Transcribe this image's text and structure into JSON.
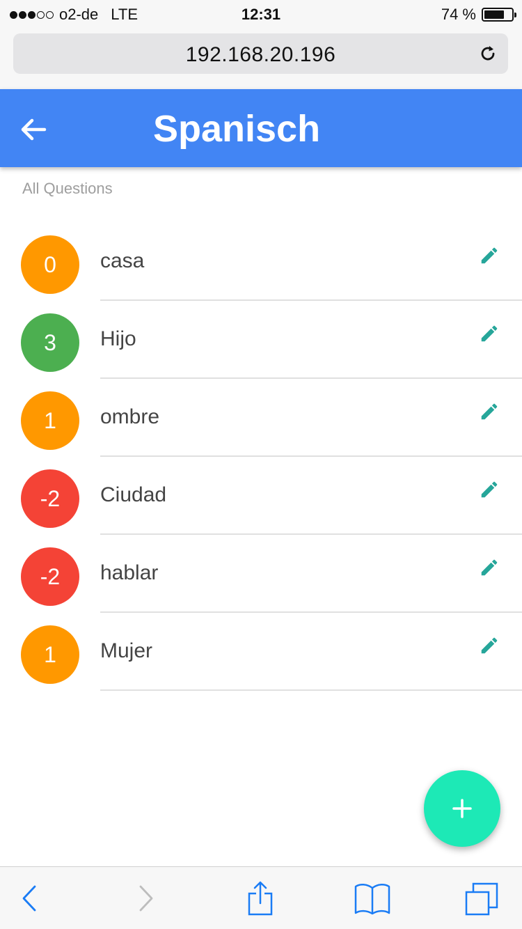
{
  "status_bar": {
    "carrier": "o2-de",
    "network": "LTE",
    "time": "12:31",
    "battery": "74 %",
    "battery_level": 0.74
  },
  "browser": {
    "url": "192.168.20.196"
  },
  "header": {
    "title": "Spanisch",
    "color": "#4285f4"
  },
  "section_label": "All Questions",
  "colors": {
    "positive": "#4caf50",
    "neutral": "#ff9800",
    "negative": "#f44336",
    "edit_icon": "#26a69a",
    "fab": "#1de9b6",
    "ios_blue": "#1a7cf5"
  },
  "questions": [
    {
      "score": "0",
      "word": "casa",
      "status": "neutral"
    },
    {
      "score": "3",
      "word": "Hijo",
      "status": "positive"
    },
    {
      "score": "1",
      "word": "ombre",
      "status": "neutral"
    },
    {
      "score": "-2",
      "word": "Ciudad",
      "status": "negative"
    },
    {
      "score": "-2",
      "word": "hablar",
      "status": "negative"
    },
    {
      "score": "1",
      "word": "Mujer",
      "status": "neutral"
    }
  ],
  "icons": {
    "header_back": "arrow-back-icon",
    "row_edit": "pencil-icon",
    "fab": "plus-icon",
    "toolbar": [
      "chevron-left-icon",
      "chevron-right-icon",
      "share-icon",
      "bookmarks-icon",
      "tabs-icon"
    ]
  }
}
